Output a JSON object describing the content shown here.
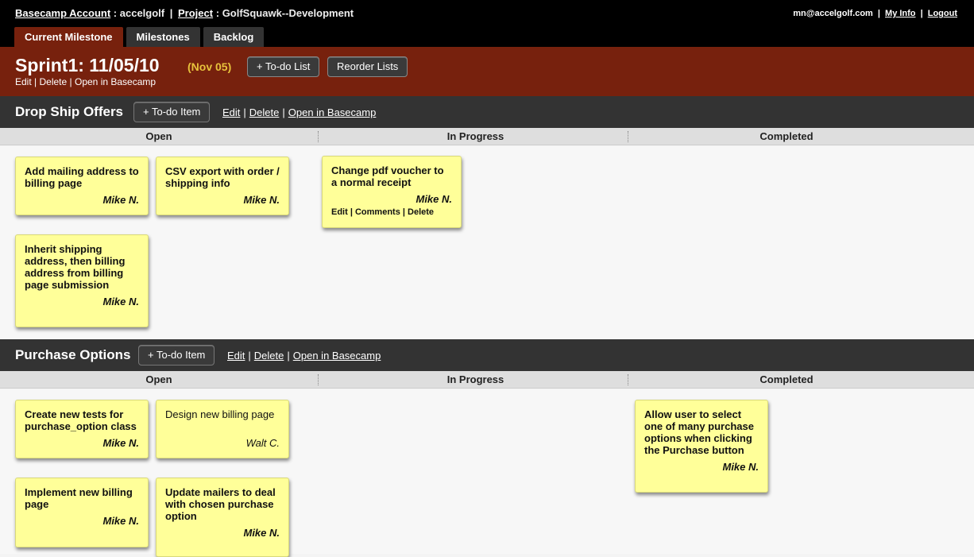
{
  "header": {
    "account_link": "Basecamp Account",
    "account_name": "accelgolf",
    "project_link": "Project",
    "project_name": "GolfSquawk--Development",
    "user_email": "mn@accelgolf.com",
    "my_info": "My Info",
    "logout": "Logout",
    "separator": "|",
    "colon": ":"
  },
  "tabs": [
    "Current Milestone",
    "Milestones",
    "Backlog"
  ],
  "milestone": {
    "title": "Sprint1: 11/05/10",
    "date": "(Nov 05)",
    "add_todo_list": "+ To-do List",
    "reorder_lists": "Reorder Lists",
    "edit": "Edit",
    "delete": "Delete",
    "open_in_basecamp": "Open in Basecamp"
  },
  "columns": [
    "Open",
    "In Progress",
    "Completed"
  ],
  "lists": [
    {
      "name": "Drop Ship Offers",
      "add_item": "+ To-do Item",
      "edit": "Edit",
      "delete": "Delete",
      "open_in_basecamp": "Open in Basecamp",
      "cards": [
        {
          "text": "Add mailing address to billing page",
          "owner": "Mike N."
        },
        {
          "text": "CSV export with order / shipping info",
          "owner": "Mike N."
        },
        {
          "text": "Change pdf voucher to a normal receipt",
          "owner": "Mike N.",
          "actions": {
            "edit": "Edit",
            "comments": "Comments",
            "delete": "Delete"
          }
        },
        {
          "text": "Inherit shipping address, then billing address from billing page submission",
          "owner": "Mike N."
        }
      ]
    },
    {
      "name": "Purchase Options",
      "add_item": "+ To-do Item",
      "edit": "Edit",
      "delete": "Delete",
      "open_in_basecamp": "Open in Basecamp",
      "cards": [
        {
          "text": "Create new tests for purchase_option class",
          "owner": "Mike N."
        },
        {
          "text": "Design new billing page",
          "owner": "Walt C."
        },
        {
          "text": "Allow user to select one of many purchase options when clicking the Purchase button",
          "owner": "Mike N."
        },
        {
          "text": "Implement new billing page",
          "owner": "Mike N."
        },
        {
          "text": "Update mailers to deal with chosen purchase option",
          "owner": "Mike N."
        }
      ]
    }
  ]
}
